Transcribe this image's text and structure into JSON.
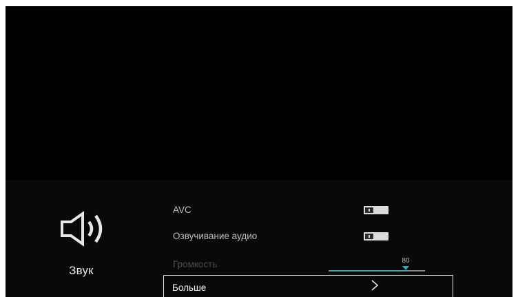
{
  "category": {
    "label": "Звук",
    "icon": "speaker-icon"
  },
  "settings": {
    "avc": {
      "label": "AVC",
      "state": "off"
    },
    "audio_description": {
      "label": "Озвучивание аудио",
      "state": "off"
    },
    "volume": {
      "label": "Громкость",
      "value": "80",
      "fraction": 0.8
    },
    "more": {
      "label": "Больше",
      "icon": "chevron-right-icon"
    }
  },
  "colors": {
    "accent": "#3aa5b8",
    "background": "#000000",
    "panel": "#090909"
  }
}
